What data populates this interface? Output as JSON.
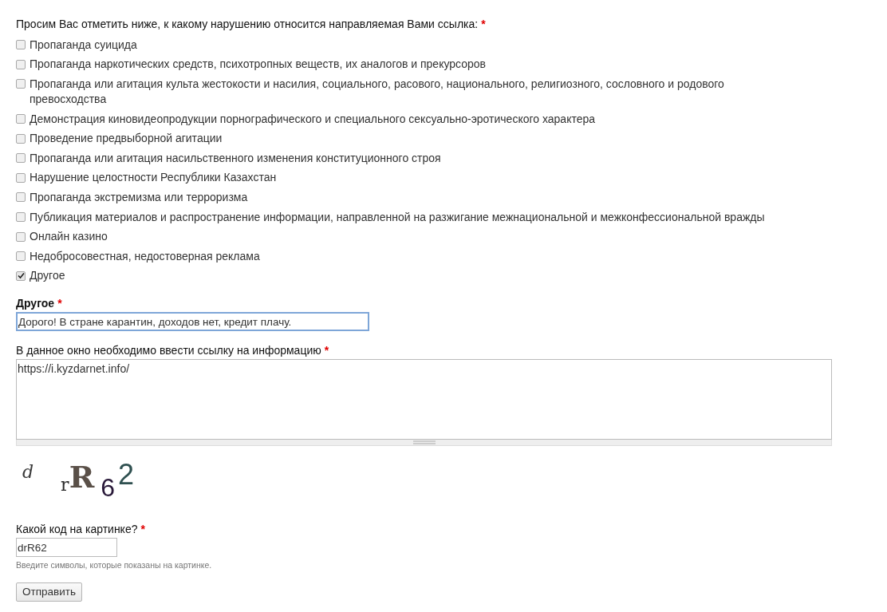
{
  "question": {
    "label": "Просим Вас отметить ниже, к какому нарушению относится направляемая Вами ссылка:",
    "required_mark": "*"
  },
  "options": [
    {
      "label": "Пропаганда суицида",
      "checked": false
    },
    {
      "label": "Пропаганда наркотических средств, психотропных веществ, их аналогов и прекурсоров",
      "checked": false
    },
    {
      "label": "Пропаганда или агитация культа жестокости и насилия, социального, расового, национального, религиозного, сословного и родового превосходства",
      "checked": false
    },
    {
      "label": "Демонстрация киновидеопродукции порнографического и специального сексуально-эротического характера",
      "checked": false
    },
    {
      "label": "Проведение предвыборной агитации",
      "checked": false
    },
    {
      "label": "Пропаганда или агитация насильственного изменения конституционного строя",
      "checked": false
    },
    {
      "label": "Нарушение целостности Республики Казахстан",
      "checked": false
    },
    {
      "label": "Пропаганда экстремизма или терроризма",
      "checked": false
    },
    {
      "label": "Публикация материалов и распространение информации, направленной на разжигание межнациональной и межконфессиональной вражды",
      "checked": false
    },
    {
      "label": "Онлайн казино",
      "checked": false
    },
    {
      "label": "Недобросовестная, недостоверная реклама",
      "checked": false
    },
    {
      "label": "Другое",
      "checked": true
    }
  ],
  "other_field": {
    "label": "Другое",
    "required_mark": "*",
    "value": "Дорого! В стране карантин, доходов нет, кредит плачу.",
    "focused": true
  },
  "link_field": {
    "label": "В данное окно необходимо ввести ссылку на информацию",
    "required_mark": "*",
    "value": "https://i.kyzdarnet.info/"
  },
  "captcha": {
    "chars": [
      {
        "char": "d",
        "color": "#3a3a3a"
      },
      {
        "char": "r",
        "color": "#2a2a2a"
      },
      {
        "char": "R",
        "color": "#5a5048"
      },
      {
        "char": "6",
        "color": "#2a1a3a"
      },
      {
        "char": "2",
        "color": "#2f5050"
      }
    ]
  },
  "code_field": {
    "label": "Какой код на картинке?",
    "required_mark": "*",
    "value": "drR62",
    "hint": "Введите символы, которые показаны на картинке."
  },
  "submit": {
    "label": "Отправить"
  }
}
